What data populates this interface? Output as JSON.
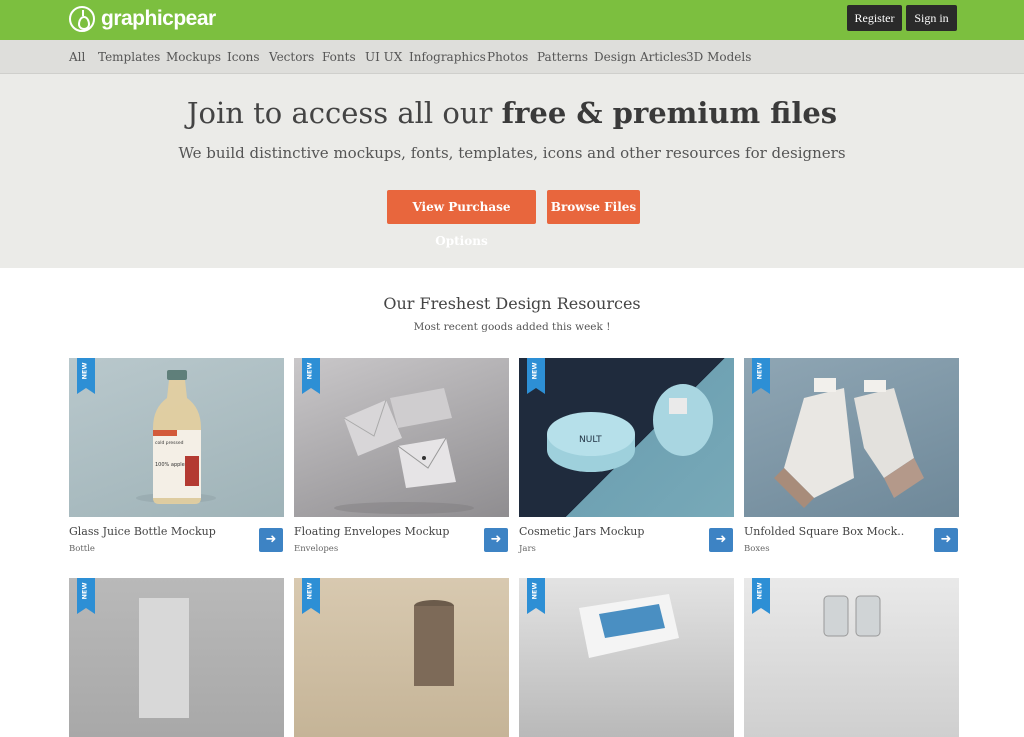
{
  "brand": {
    "name": "graphicpear",
    "logo_icon": "pear-icon",
    "accent": "#7cbf3f"
  },
  "auth": {
    "register": "Register",
    "signin": "Sign in"
  },
  "nav": [
    "All",
    "Templates",
    "Mockups",
    "Icons",
    "Vectors",
    "Fonts",
    "UI UX",
    "Infographics",
    "Photos",
    "Patterns",
    "Design Articles",
    "3D Models"
  ],
  "hero": {
    "title_prefix": "Join to access all our",
    "title_bold": "free & premium files",
    "subtitle": "We build distinctive mockups, fonts, templates, icons and other resources for designers",
    "btn_purchase": "View Purchase Options",
    "btn_browse": "Browse Files",
    "button_color": "#e8663d"
  },
  "section": {
    "title": "Our Freshest Design Resources",
    "subtitle": "Most recent goods added this week !"
  },
  "badge_label": "NEW",
  "badge_color": "#2d8fd5",
  "cards": [
    {
      "title": "Glass Juice Bottle Mockup",
      "category": "Bottle",
      "arrow_icon": "arrow-right-icon"
    },
    {
      "title": "Floating Envelopes Mockup",
      "category": "Envelopes",
      "arrow_icon": "arrow-right-icon"
    },
    {
      "title": "Cosmetic Jars Mockup",
      "category": "Jars",
      "arrow_icon": "arrow-right-icon"
    },
    {
      "title": "Unfolded Square Box Mock..",
      "category": "Boxes",
      "arrow_icon": "arrow-right-icon"
    }
  ],
  "product_art": {
    "bottle": [
      "cold pressed",
      "100% apple"
    ],
    "jar_lid": "NULT"
  }
}
